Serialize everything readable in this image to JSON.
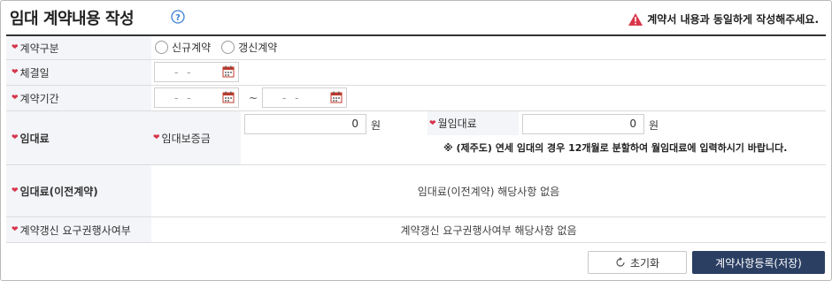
{
  "header": {
    "title": "임대 계약내용 작성",
    "notice": "계약서 내용과 동일하게 작성해주세요."
  },
  "form": {
    "contract_type": {
      "label": "계약구분",
      "options": [
        "신규계약",
        "갱신계약"
      ]
    },
    "signing_date": {
      "label": "체결일",
      "date_placeholder": "-  -"
    },
    "contract_period": {
      "label": "계약기간",
      "start_placeholder": "-  -",
      "separator": "~",
      "end_placeholder": "-  -"
    },
    "rent": {
      "label": "임대료",
      "deposit_label": "임대보증금",
      "deposit_value": "0",
      "deposit_unit": "원",
      "monthly_label": "월임대료",
      "monthly_value": "0",
      "monthly_unit": "원",
      "note": "※ (제주도) 연세 임대의 경우 12개월로 분할하여 월임대료에 입력하시기 바랍니다."
    },
    "prev_rent": {
      "label": "임대료(이전계약)",
      "value": "임대료(이전계약) 해당사항 없음"
    },
    "renewal_right": {
      "label": "계약갱신 요구권행사여부",
      "value": "계약갱신 요구권행사여부 해당사항 없음"
    }
  },
  "buttons": {
    "reset_label": "초기화",
    "save_label": "계약사항등록(저장)"
  },
  "colors": {
    "required_mark": "#d6344a",
    "warning": "#d9354a",
    "save_button": "#2b3f63",
    "label_bg": "#f3f5f8"
  },
  "icons": {
    "help": "question-circle-icon",
    "warning": "warning-triangle-icon",
    "calendar": "calendar-icon",
    "reset": "refresh-icon"
  }
}
